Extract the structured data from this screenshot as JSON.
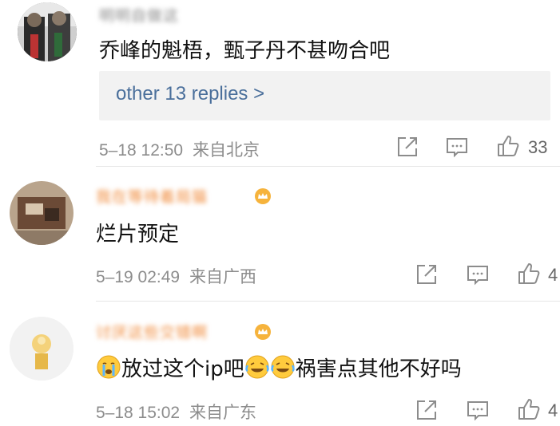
{
  "comments": [
    {
      "username": "明明自做这",
      "text": "乔峰的魁梧，甄子丹不甚吻合吧",
      "replies_label": "other 13 replies >",
      "time": "5–18 12:50",
      "location": "来自北京",
      "likes": "33"
    },
    {
      "username": "我在等待着局猫",
      "text": "烂片预定",
      "time": "5–19 02:49",
      "location": "来自广西",
      "likes": "4"
    },
    {
      "username": "讨厌这些交错啊",
      "text_parts": [
        "放过这个ip吧",
        "祸害点其他不好吗"
      ],
      "emoji_icons": [
        "crying-face-icon",
        "laughing-tears-icon",
        "laughing-tears-icon"
      ],
      "time": "5–18 15:02",
      "location": "来自广东",
      "likes": "4"
    }
  ],
  "colors": {
    "username_gray": "#8a8a8a",
    "username_vip": "#f08a3a",
    "link": "#4a6f9b",
    "meta": "#8c8c8c"
  }
}
